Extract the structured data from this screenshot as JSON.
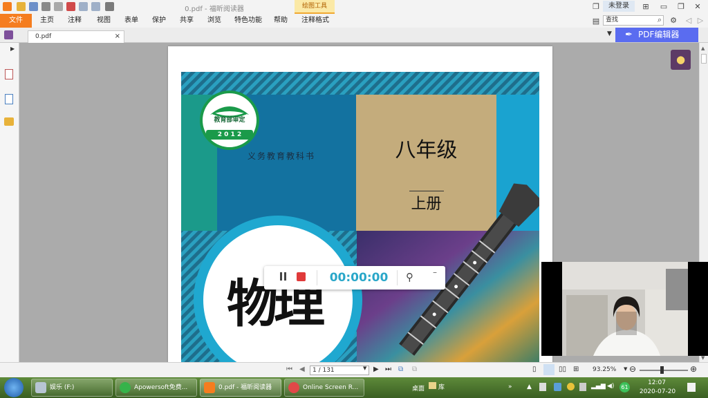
{
  "titlebar": {
    "document_title": "0.pdf - 福昕阅读器",
    "context_tab": "绘图工具",
    "login_button": "未登录"
  },
  "menu": {
    "file": "文件",
    "items": [
      "主页",
      "注释",
      "视图",
      "表单",
      "保护",
      "共享",
      "浏览",
      "特色功能",
      "帮助",
      "注释格式"
    ],
    "search_value": "查找"
  },
  "tabs": {
    "doc_tab": "0.pdf",
    "close_symbol": "×",
    "pdf_editor": "PDF编辑器"
  },
  "cover": {
    "seal_top": "教育部审定",
    "seal_year": "2 0 1 2",
    "series": "义务教育教科书",
    "grade": "八年级",
    "volume": "上册",
    "subject": "物理"
  },
  "recorder": {
    "timer": "00:00:00"
  },
  "statusbar": {
    "page_value": "1 / 131",
    "zoom": "93.25%"
  },
  "taskbar": {
    "items": [
      "娱乐 (F:)",
      "Apowersoft免费...",
      "0.pdf - 福昕阅读器",
      "Online Screen R..."
    ],
    "desktop": "桌面",
    "library": "库",
    "badge": "61",
    "time": "12:07",
    "date": "2020-07-20"
  },
  "colors": {
    "file_tab": "#f57d1f",
    "pdf_editor": "#5a6cf0",
    "timer": "#2aa7c9",
    "cover_teal": "#0e86a5",
    "cover_tan": "#c4ac7c",
    "seal_green": "#1a9a4a"
  }
}
